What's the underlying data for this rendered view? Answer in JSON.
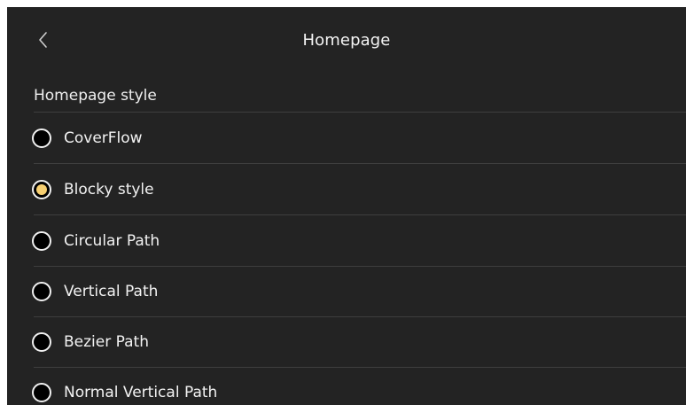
{
  "header": {
    "title": "Homepage",
    "back_icon": "chevron-left-icon"
  },
  "section": {
    "title": "Homepage style"
  },
  "options": [
    {
      "label": "CoverFlow",
      "selected": false
    },
    {
      "label": "Blocky style",
      "selected": true
    },
    {
      "label": "Circular Path",
      "selected": false
    },
    {
      "label": "Vertical Path",
      "selected": false
    },
    {
      "label": "Bezier Path",
      "selected": false
    },
    {
      "label": "Normal Vertical Path",
      "selected": false
    }
  ],
  "colors": {
    "background": "#232323",
    "text": "#f2f2f2",
    "accent": "#f6cf71",
    "divider": "#3e3e3e"
  }
}
